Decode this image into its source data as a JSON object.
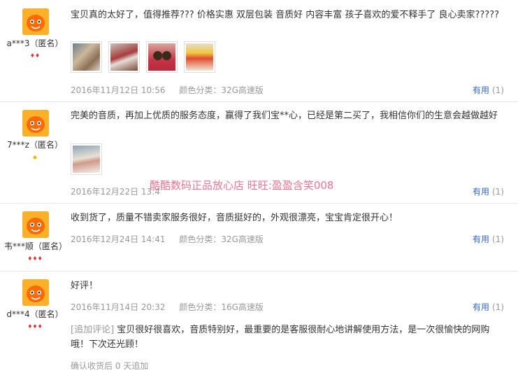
{
  "reviews": [
    {
      "username": "a***3（匿名）",
      "rank_icons": "♦♦",
      "content": "宝贝真的太好了，值得推荐??? 价格实惠 双层包装 音质好 内容丰富 孩子喜欢的爱不释手了 良心卖家?????",
      "date": "2016年11月12日 10:56",
      "sku": "颜色分类：32G高速版",
      "useful_label": "有用",
      "useful_count": "(1)"
    },
    {
      "username": "7***z（匿名）",
      "rank_icons": "◆",
      "content": "完美的音质，再加上优质的服务态度，赢得了我们宝**心，已经是第二买了，我相信你们的生意会越做越好",
      "date": "2016年12月22日 13:4",
      "sku": "",
      "useful_label": "有用",
      "useful_count": "(1)"
    },
    {
      "username": "韦***顺（匿名）",
      "rank_icons": "♦♦♦",
      "content": "收到货了，质量不错卖家服务很好，音质挺好的，外观很漂亮，宝宝肯定很开心！",
      "date": "2016年12月24日 14:41",
      "sku": "颜色分类：32G高速版",
      "useful_label": "有用",
      "useful_count": "(1)"
    },
    {
      "username": "d***4（匿名）",
      "rank_icons": "♦♦♦",
      "content": "好评！",
      "date": "2016年11月14日 20:32",
      "sku": "颜色分类：16G高速版",
      "useful_label": "有用",
      "useful_count": "(1)",
      "append_label": "[追加评论]",
      "append_content": "宝贝很好很喜欢，音质特别好，最重要的是客服很耐心地讲解使用方法，是一次很愉快的网购哦！下次还光顾！",
      "append_meta": "确认收货后 0 天追加"
    }
  ],
  "watermark": "酷酷数码正品放心店 旺旺:盈盈含笑008",
  "colors": {
    "avatar_bg": "#fbb02a",
    "link": "#3366cc",
    "meta": "#999999",
    "rank_heart": "#e2312f",
    "rank_diamond": "#f5b400"
  }
}
